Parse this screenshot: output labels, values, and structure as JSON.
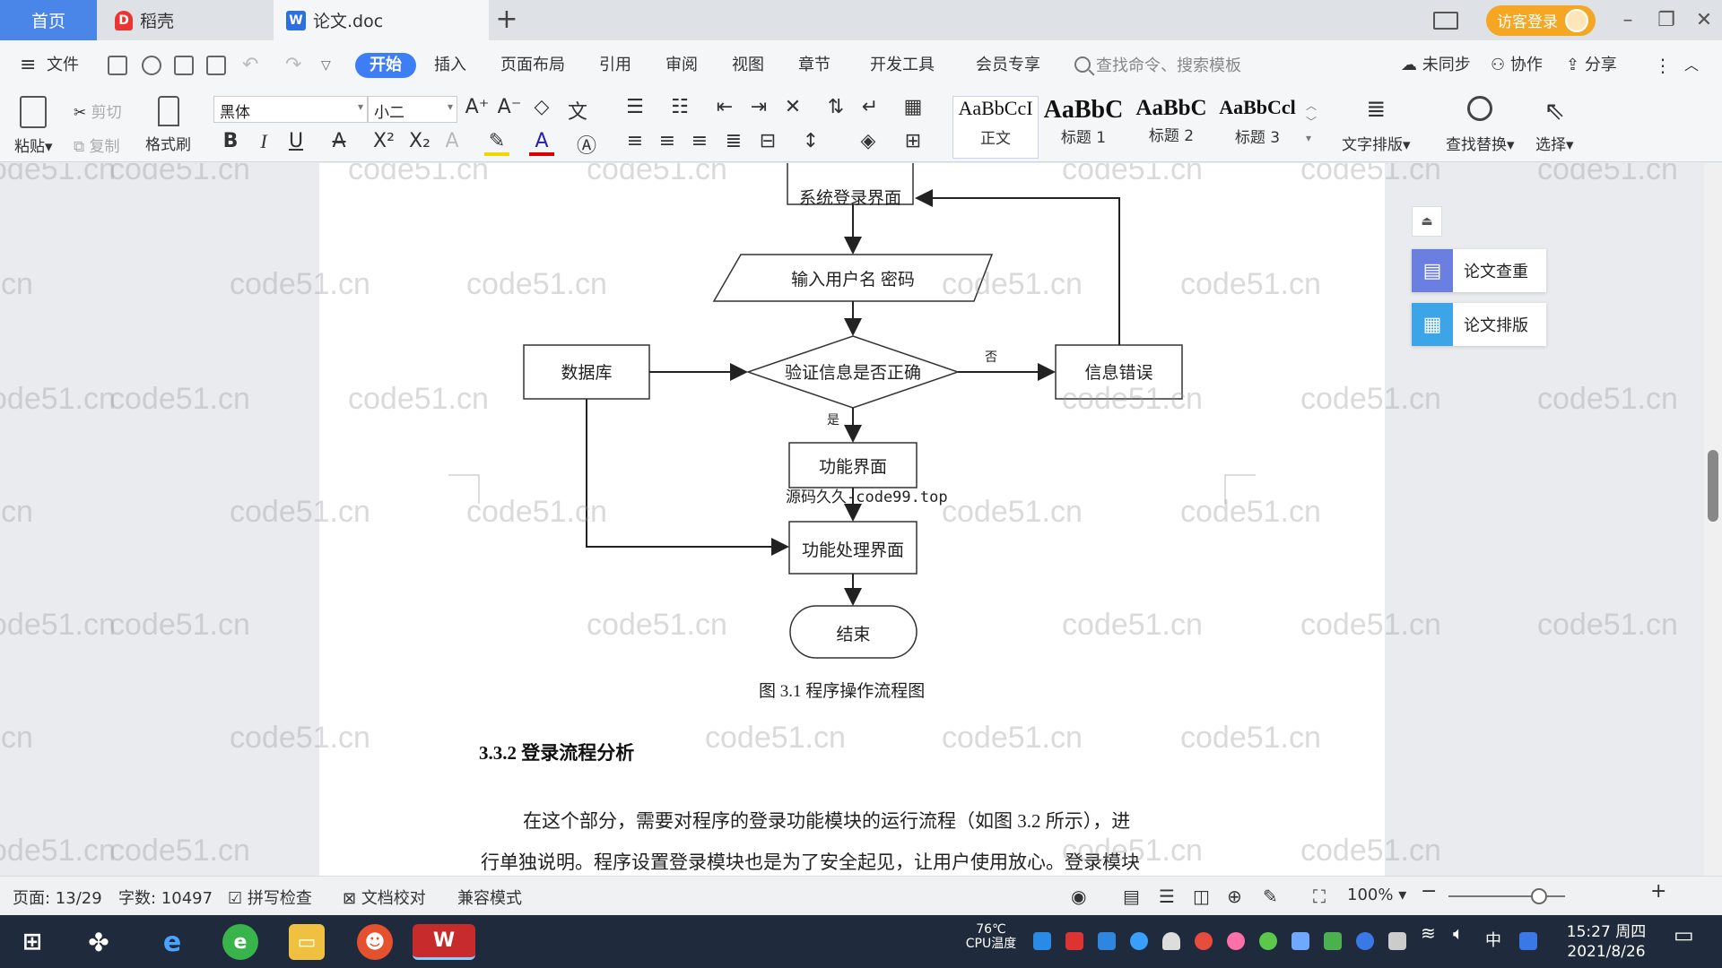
{
  "titlebar": {
    "tabs": [
      {
        "label": "首页"
      },
      {
        "label": "稻壳"
      },
      {
        "label": "论文.doc"
      }
    ],
    "login_label": "访客登录"
  },
  "menubar": {
    "file_label": "文件",
    "items": [
      "开始",
      "插入",
      "页面布局",
      "引用",
      "审阅",
      "视图",
      "章节",
      "开发工具",
      "会员专享"
    ],
    "search_placeholder": "查找命令、搜索模板",
    "right": [
      "未同步",
      "协作",
      "分享"
    ]
  },
  "ribbon": {
    "paste": "粘贴",
    "cut": "剪切",
    "copy": "复制",
    "format_painter": "格式刷",
    "font_name": "黑体",
    "font_size": "小二",
    "styles": [
      {
        "sample": "AaBbCcI",
        "name": "正文"
      },
      {
        "sample": "AaBbC",
        "name": "标题 1"
      },
      {
        "sample": "AaBbC",
        "name": "标题 2"
      },
      {
        "sample": "AaBbCcl",
        "name": "标题 3"
      }
    ],
    "text_layout": "文字排版",
    "find_replace": "查找替换",
    "select": "选择"
  },
  "flowchart": {
    "nodes": {
      "login": "系统登录界面",
      "input": "输入用户名 密码",
      "database": "数据库",
      "verify": "验证信息是否正确",
      "error": "信息错误",
      "function": "功能界面",
      "process": "功能处理界面",
      "end": "结束"
    },
    "labels": {
      "no": "否",
      "yes": "是"
    },
    "overlay_text": "源码久久-code99.top",
    "caption": "图 3.1  程序操作流程图"
  },
  "document": {
    "heading": "3.3.2  登录流程分析",
    "para_line1": "在这个部分，需要对程序的登录功能模块的运行流程（如图 3.2 所示），进",
    "para_line2": "行单独说明。程序设置登录模块也是为了安全起见，让用户使用放心。登录模块",
    "watermark": "code51.cn"
  },
  "side_panel": {
    "items": [
      {
        "label": "论文查重",
        "color": "#6b7fe0"
      },
      {
        "label": "论文排版",
        "color": "#3ba5e8"
      }
    ]
  },
  "statusbar": {
    "page": "页面: 13/29",
    "words": "字数: 10497",
    "spell": "拼写检查",
    "proof": "文档校对",
    "compat": "兼容模式",
    "zoom": "100%"
  },
  "taskbar": {
    "temp": "76℃",
    "temp_label": "CPU温度",
    "time": "15:27 周四",
    "date": "2021/8/26",
    "ime": "中"
  }
}
